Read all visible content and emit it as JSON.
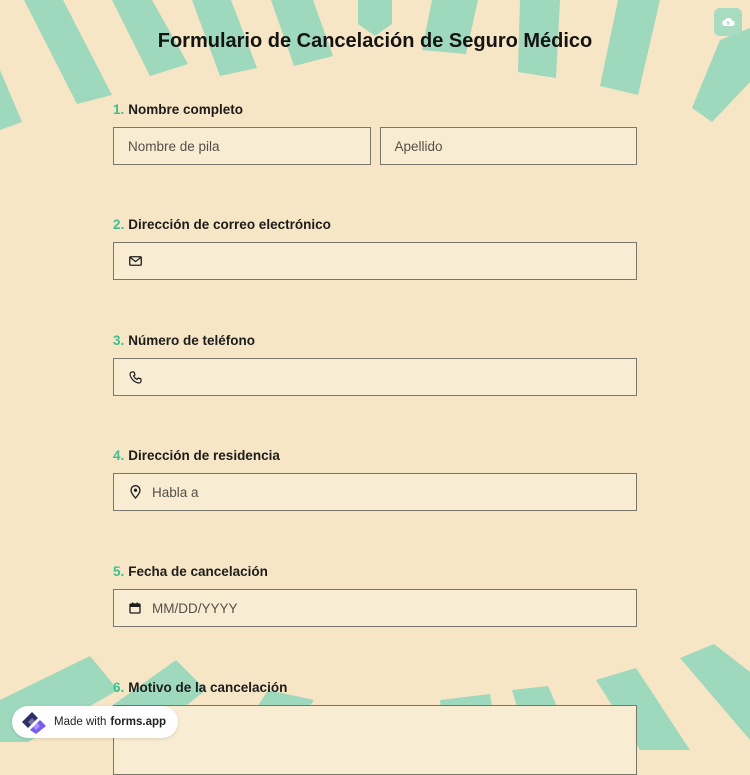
{
  "form": {
    "title": "Formulario de Cancelación de Seguro Médico",
    "save_icon": "cloud-upload-icon"
  },
  "questions": [
    {
      "number": "1.",
      "label": "Nombre completo",
      "first_name_placeholder": "Nombre de pila",
      "last_name_placeholder": "Apellido"
    },
    {
      "number": "2.",
      "label": "Dirección de correo electrónico",
      "icon": "envelope-icon",
      "value": ""
    },
    {
      "number": "3.",
      "label": "Número de teléfono",
      "icon": "phone-icon",
      "value": ""
    },
    {
      "number": "4.",
      "label": "Dirección de residencia",
      "icon": "map-pin-icon",
      "placeholder": "Habla a"
    },
    {
      "number": "5.",
      "label": "Fecha de cancelación",
      "icon": "calendar-icon",
      "placeholder": "MM/DD/YYYY"
    },
    {
      "number": "6.",
      "label": "Motivo de la cancelación"
    }
  ],
  "badge": {
    "prefix": "Made with",
    "brand": "forms.app"
  },
  "colors": {
    "background": "#f6e6c5",
    "stripe": "#9ed8bd",
    "accent_number": "#3fbf8f",
    "field_bg": "#f8ecd2",
    "field_border": "#7a766c"
  }
}
